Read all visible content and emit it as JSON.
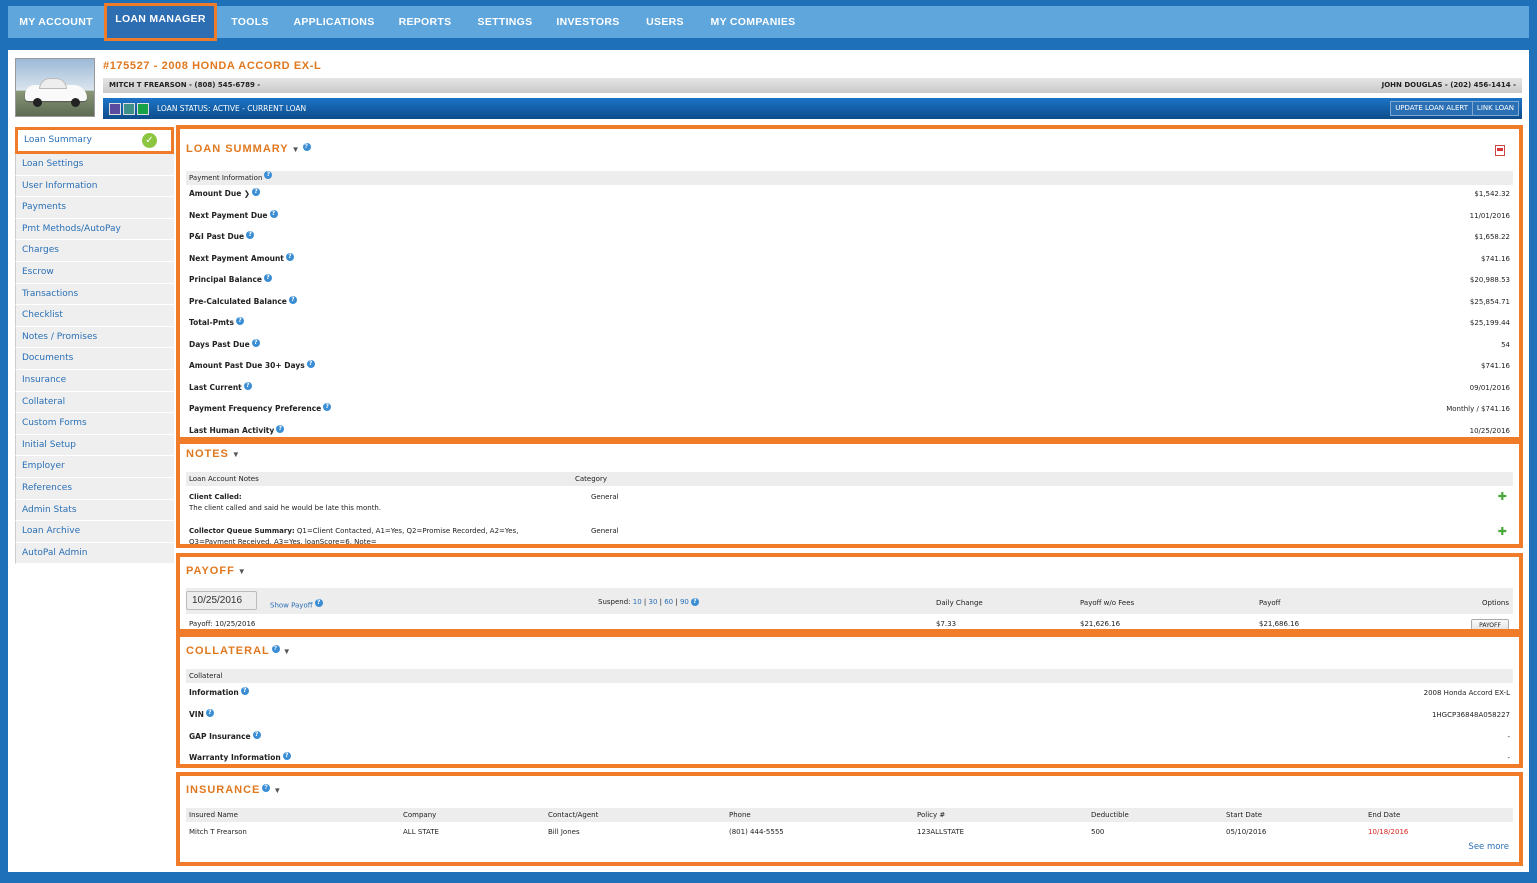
{
  "nav": {
    "items": [
      "MY ACCOUNT",
      "LOAN MANAGER",
      "TOOLS",
      "APPLICATIONS",
      "REPORTS",
      "SETTINGS",
      "INVESTORS",
      "USERS",
      "MY COMPANIES"
    ],
    "active_index": 1
  },
  "header": {
    "title": "#175527 - 2008 HONDA ACCORD EX-L",
    "borrower": "MITCH T FREARSON - (808) 545-6789 -",
    "co_borrower": "JOHN DOUGLAS - (202) 456-1414 -",
    "status": "LOAN STATUS: ACTIVE - CURRENT LOAN",
    "update_alert_btn": "UPDATE LOAN ALERT",
    "link_loan_btn": "LINK LOAN",
    "status_colors": [
      "#5a4b9e",
      "#3f8f8a",
      "#17a24a"
    ]
  },
  "sidebar": {
    "items": [
      "Loan Summary",
      "Loan Settings",
      "User Information",
      "Payments",
      "Pmt Methods/AutoPay",
      "Charges",
      "Escrow",
      "Transactions",
      "Checklist",
      "Notes / Promises",
      "Documents",
      "Insurance",
      "Collateral",
      "Custom Forms",
      "Initial Setup",
      "Employer",
      "References",
      "Admin Stats",
      "Loan Archive",
      "AutoPal Admin"
    ]
  },
  "summary": {
    "title": "LOAN SUMMARY",
    "section_header": "Payment Information",
    "rows": [
      {
        "label": "Amount Due",
        "value": "$1,542.32"
      },
      {
        "label": "Next Payment Due",
        "value": "11/01/2016"
      },
      {
        "label": "P&I Past Due",
        "value": "$1,658.22"
      },
      {
        "label": "Next Payment Amount",
        "value": "$741.16"
      },
      {
        "label": "Principal Balance",
        "value": "$20,988.53"
      },
      {
        "label": "Pre-Calculated Balance",
        "value": "$25,854.71"
      },
      {
        "label": "Total-Pmts",
        "value": "$25,199.44"
      },
      {
        "label": "Days Past Due",
        "value": "54"
      },
      {
        "label": "Amount Past Due 30+ Days",
        "value": "$741.16"
      },
      {
        "label": "Last Current",
        "value": "09/01/2016"
      },
      {
        "label": "Payment Frequency Preference",
        "value": "Monthly / $741.16"
      },
      {
        "label": "Last Human Activity",
        "value": "10/25/2016"
      }
    ]
  },
  "notes": {
    "title": "NOTES",
    "col_notes": "Loan Account Notes",
    "col_category": "Category",
    "items": [
      {
        "title": "Client Called:",
        "body": "The client called and said he would be late this month.",
        "category": "General"
      },
      {
        "title": "Collector Queue Summary:",
        "body": "Q1=Client Contacted, A1=Yes, Q2=Promise Recorded, A2=Yes,",
        "body2": "Q3=Payment Received, A3=Yes, loanScore=6, Note=",
        "category": "General"
      }
    ]
  },
  "payoff": {
    "title": "PAYOFF",
    "date_value": "10/25/2016",
    "show_payoff": "Show Payoff",
    "suspend_label": "Suspend:",
    "suspend_10": "10",
    "suspend_30": "30",
    "suspend_60": "60",
    "suspend_90": "90",
    "col_daily": "Daily Change",
    "col_wo_fees": "Payoff w/o Fees",
    "col_payoff": "Payoff",
    "col_options": "Options",
    "row_label": "Payoff: 10/25/2016",
    "daily": "$7.33",
    "wo_fees": "$21,626.16",
    "payoff_value": "$21,686.16",
    "payoff_btn": "PAYOFF"
  },
  "collateral": {
    "title": "COLLATERAL",
    "section_header": "Collateral",
    "rows": [
      {
        "label": "Information",
        "value": "2008 Honda Accord EX-L"
      },
      {
        "label": "VIN",
        "value": "1HGCP36848A058227"
      },
      {
        "label": "GAP Insurance",
        "value": "-"
      },
      {
        "label": "Warranty Information",
        "value": "-"
      }
    ]
  },
  "insurance": {
    "title": "INSURANCE",
    "headers": [
      "Insured Name",
      "Company",
      "Contact/Agent",
      "Phone",
      "Policy #",
      "Deductible",
      "Start Date",
      "End Date"
    ],
    "row": [
      "Mitch T Frearson",
      "ALL STATE",
      "Bill Jones",
      "(801) 444-5555",
      "123ALLSTATE",
      "500",
      "05/10/2016",
      "10/18/2016"
    ],
    "see_more": "See more"
  }
}
